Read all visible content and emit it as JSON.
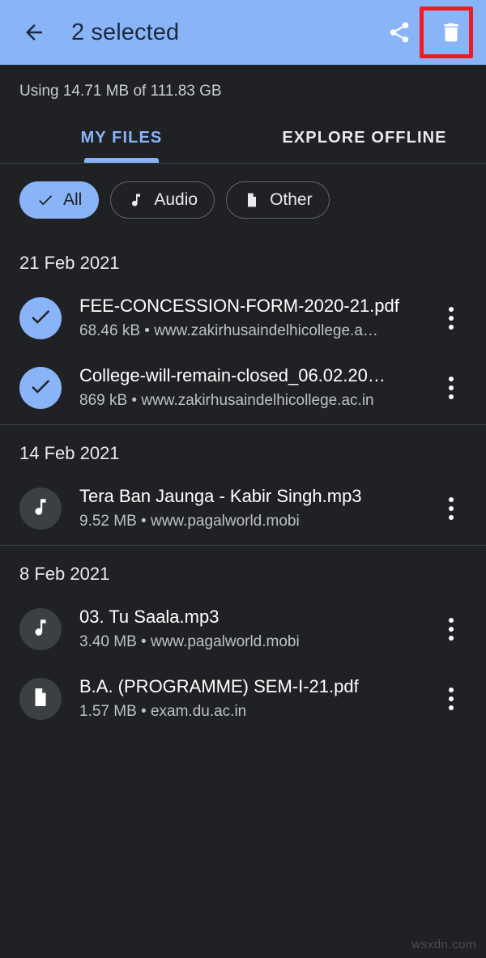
{
  "appbar": {
    "back_icon": "arrow-back-icon",
    "title": "2 selected",
    "share_icon": "share-icon",
    "delete_icon": "trash-icon",
    "bg_color": "#8ab4f8",
    "title_color": "#1c2a3d",
    "highlight_color": "#ee1b24"
  },
  "storage": {
    "text": "Using 14.71 MB of 111.83 GB"
  },
  "tabs": [
    {
      "label": "MY FILES",
      "active": true
    },
    {
      "label": "EXPLORE OFFLINE",
      "active": false
    }
  ],
  "chips": [
    {
      "label": "All",
      "icon": "check-icon",
      "selected": true
    },
    {
      "label": "Audio",
      "icon": "music-note-icon",
      "selected": false
    },
    {
      "label": "Other",
      "icon": "document-icon",
      "selected": false
    }
  ],
  "groups": [
    {
      "date": "21 Feb 2021",
      "files": [
        {
          "name": "FEE-CONCESSION-FORM-2020-21.pdf",
          "meta": "68.46 kB • www.zakirhusaindelhicollege.a…",
          "icon": "check-icon",
          "selected": true
        },
        {
          "name": "College-will-remain-closed_06.02.20…",
          "meta": "869 kB • www.zakirhusaindelhicollege.ac.in",
          "icon": "check-icon",
          "selected": true
        }
      ]
    },
    {
      "date": "14 Feb 2021",
      "files": [
        {
          "name": "Tera Ban Jaunga - Kabir Singh.mp3",
          "meta": "9.52 MB • www.pagalworld.mobi",
          "icon": "music-note-icon",
          "selected": false
        }
      ]
    },
    {
      "date": "8 Feb 2021",
      "files": [
        {
          "name": "03. Tu Saala.mp3",
          "meta": "3.40 MB • www.pagalworld.mobi",
          "icon": "music-note-icon",
          "selected": false
        },
        {
          "name": "B.A. (PROGRAMME) SEM-I-21.pdf",
          "meta": "1.57 MB • exam.du.ac.in",
          "icon": "document-icon",
          "selected": false
        }
      ]
    }
  ],
  "watermark": "wsxdn.com"
}
